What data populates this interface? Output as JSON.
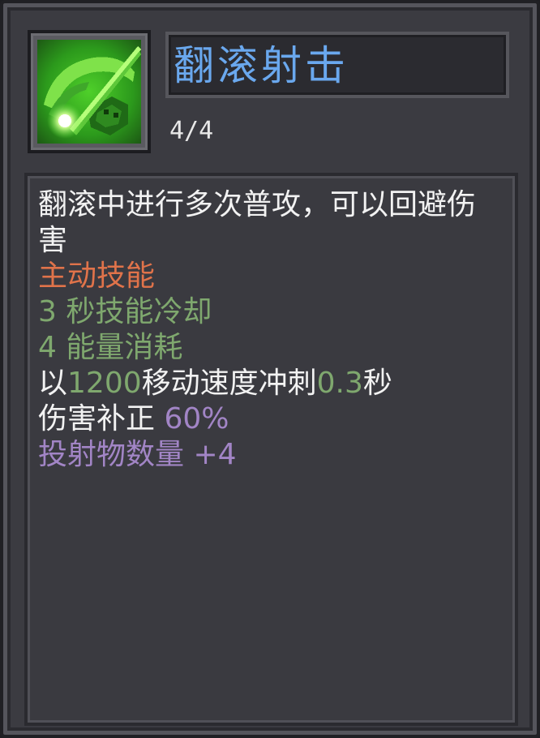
{
  "skill": {
    "name": "翻滚射击",
    "level": "4/4",
    "icon": "crossbow-dash-icon"
  },
  "description": {
    "text": "翻滚中进行多次普攻，可以回避伤害",
    "type": "主动技能",
    "cooldown": "3 秒技能冷却",
    "cost": "4 能量消耗",
    "dash_prefix": "以",
    "dash_speed": "1200",
    "dash_middle": "移动速度冲刺",
    "dash_duration": "0.3",
    "dash_suffix": "秒",
    "damage_label": "伤害补正",
    "damage_value": "60%",
    "projectile_label": "投射物数量",
    "projectile_value": "+4"
  },
  "colors": {
    "title": "#6aa8ee",
    "type": "#e0734a",
    "stat": "#7fa86e",
    "modifier": "#a285c6",
    "text": "#f2f2f2"
  }
}
